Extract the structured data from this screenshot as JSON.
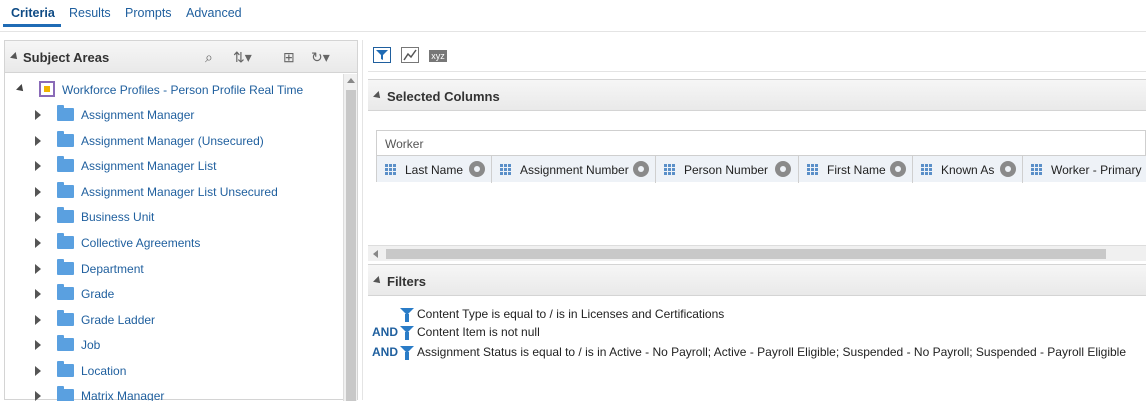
{
  "tabs": [
    "Criteria",
    "Results",
    "Prompts",
    "Advanced"
  ],
  "subject_areas": {
    "title": "Subject Areas",
    "root_label": "Workforce Profiles - Person Profile Real Time",
    "items": [
      "Assignment Manager",
      "Assignment Manager (Unsecured)",
      "Assignment Manager List",
      "Assignment Manager List Unsecured",
      "Business Unit",
      "Collective Agreements",
      "Department",
      "Grade",
      "Grade Ladder",
      "Job",
      "Location",
      "Matrix Manager"
    ]
  },
  "toolbar": {
    "icons": [
      "filter-icon",
      "chart-edit-icon",
      "xyz-icon"
    ],
    "xyz_text": "xyz"
  },
  "selected_columns": {
    "title": "Selected Columns",
    "group_label": "Worker",
    "columns": [
      "Last Name",
      "Assignment Number",
      "Person Number",
      "First Name",
      "Known As",
      "Worker - Primary"
    ]
  },
  "filters": {
    "title": "Filters",
    "rows": [
      {
        "conjunction": "",
        "text": "Content Type is equal to / is in  Licenses and Certifications"
      },
      {
        "conjunction": "AND",
        "text": "Content Item is not null"
      },
      {
        "conjunction": "AND",
        "text": "Assignment Status is equal to / is in  Active - No Payroll; Active - Payroll Eligible; Suspended - No Payroll; Suspended - Payroll Eligible"
      }
    ]
  }
}
